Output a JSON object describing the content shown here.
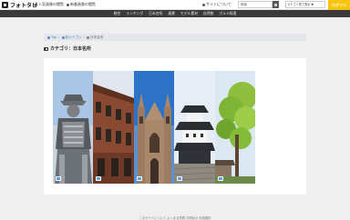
{
  "header": {
    "logo_text": "フォトタピ",
    "links": [
      "人気画像の閲覧",
      "新着画像の閲覧",
      "サイトについて"
    ],
    "search_value": "検索",
    "select_value": "カテゴリ別で表示 ▼",
    "login_label": "ログイン"
  },
  "nav": {
    "items": [
      "総合",
      "ランキング",
      "日本名所",
      "風景",
      "モデル素材",
      "自然物",
      "グルメ料理"
    ]
  },
  "breadcrumb": {
    "items": [
      "Top",
      "各カテゴリ",
      "日本名所"
    ]
  },
  "page": {
    "title": "カテゴリ：日本名所"
  },
  "gallery": {
    "tiles": [
      {
        "icon": "samurai-armor-statue"
      },
      {
        "icon": "red-brick-building"
      },
      {
        "icon": "cathedral"
      },
      {
        "icon": "japanese-castle"
      },
      {
        "icon": "tree-and-temple"
      }
    ],
    "accent": "#5aa0e0"
  },
  "footer": {
    "text": "このサイトについて  よくある質問  お問合せ  利用規約"
  },
  "colors": {
    "accent_yellow": "#f7c40f",
    "nav_bg": "#3a3a3a",
    "link_blue": "#4a7fc0"
  }
}
